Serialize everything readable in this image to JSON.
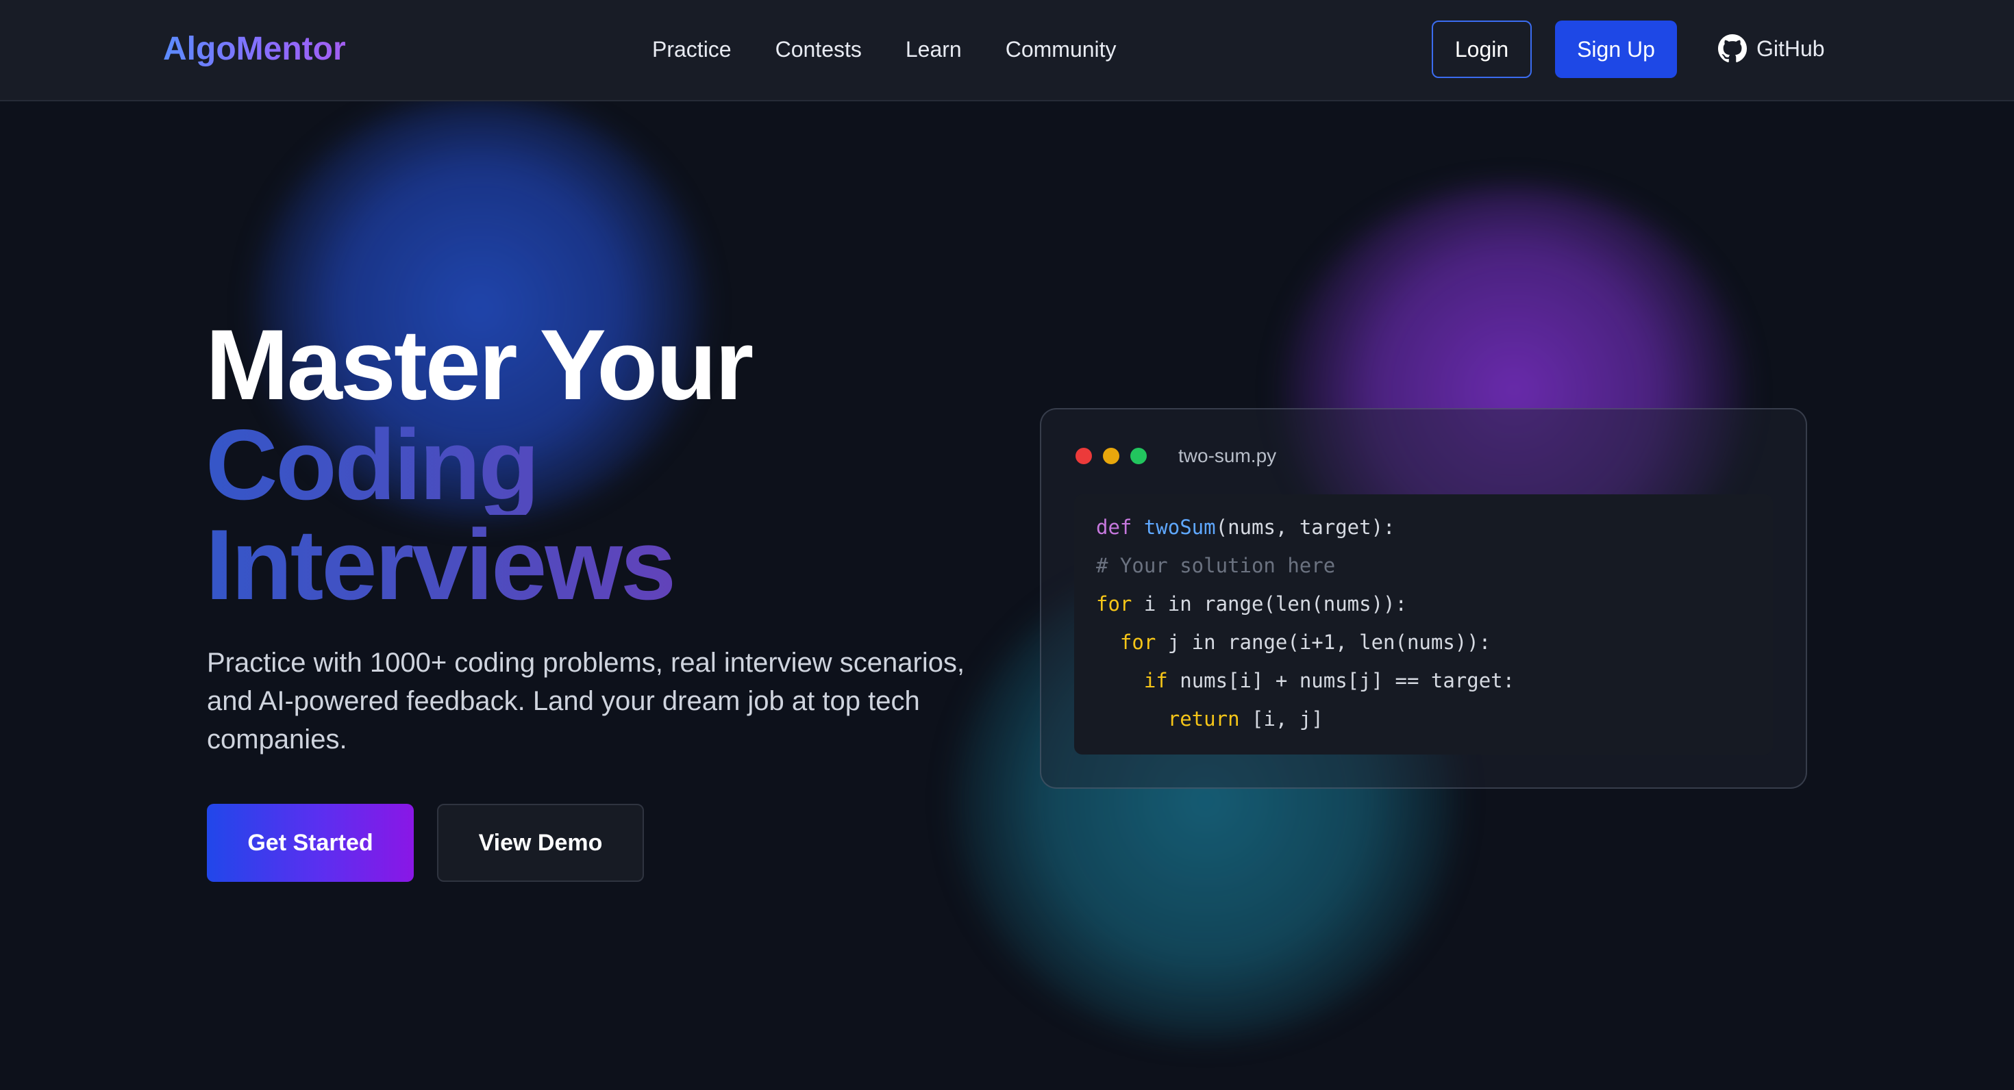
{
  "navbar": {
    "brand": "AlgoMentor",
    "links": [
      "Practice",
      "Contests",
      "Learn",
      "Community"
    ],
    "login_label": "Login",
    "signup_label": "Sign Up",
    "github_label": "GitHub",
    "github_icon": "github-icon"
  },
  "hero": {
    "title_line1": "Master Your",
    "title_line2": "Coding",
    "title_line3": "Interviews",
    "subtitle": "Practice with 1000+ coding problems, real interview scenarios, and AI-powered feedback. Land your dream job at top tech companies.",
    "primary_button": "Get Started",
    "secondary_button": "View Demo"
  },
  "code_window": {
    "filename": "two-sum.py",
    "lines": [
      {
        "indent": "",
        "parts": [
          [
            "kw",
            "def "
          ],
          [
            "fn",
            "twoSum"
          ],
          [
            "",
            "(nums, target):"
          ]
        ]
      },
      {
        "indent": "",
        "parts": [
          [
            "cm",
            "# Your solution here"
          ]
        ]
      },
      {
        "indent": "",
        "parts": [
          [
            "kw2",
            "for "
          ],
          [
            "",
            "i in range(len(nums)):"
          ]
        ]
      },
      {
        "indent": "  ",
        "parts": [
          [
            "kw2",
            "for "
          ],
          [
            "",
            "j in range(i+1, len(nums)):"
          ]
        ]
      },
      {
        "indent": "    ",
        "parts": [
          [
            "kw2",
            "if "
          ],
          [
            "",
            "nums[i] + nums[j] == target:"
          ]
        ]
      },
      {
        "indent": "      ",
        "parts": [
          [
            "kw2",
            "return "
          ],
          [
            "",
            "[i, j]"
          ]
        ]
      }
    ]
  },
  "colors": {
    "background": "#0d111b",
    "navbar": "#181c26",
    "accent_blue": "#1e48e6",
    "traffic_red": "#ec3a3a",
    "traffic_yellow": "#e8a70c",
    "traffic_green": "#22c55e"
  }
}
